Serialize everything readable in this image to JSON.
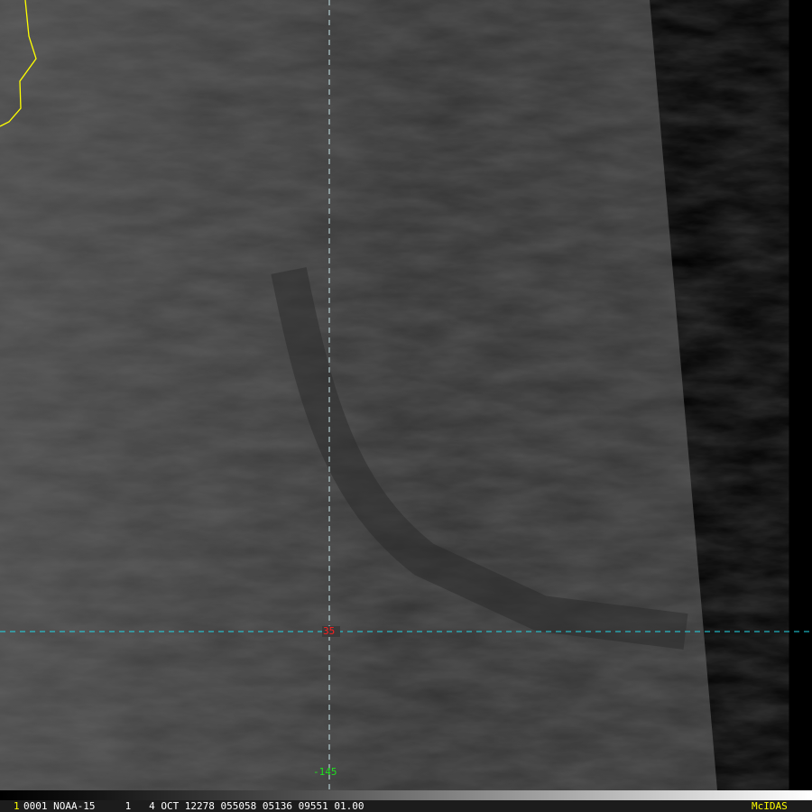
{
  "image": {
    "latitude_label": "35",
    "longitude_label": "-145",
    "lat_color": "#ff2020",
    "lon_color": "#20e020",
    "grid_color": "#20d8e8",
    "coast_color": "#ffff00"
  },
  "status_bar": {
    "frame": "1",
    "info": "0001 NOAA-15     1   4 OCT 12278 055058 05136 09551 01.00",
    "brand": "McIDAS"
  }
}
